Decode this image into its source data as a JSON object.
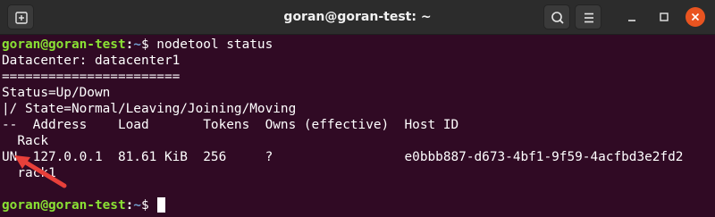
{
  "window": {
    "title": "goran@goran-test: ~"
  },
  "titlebar_buttons": {
    "new_tab_icon": "new-tab-icon",
    "search_icon": "search-icon",
    "menu_icon": "hamburger-menu-icon",
    "minimize_icon": "minimize-icon",
    "maximize_icon": "maximize-icon",
    "close_icon": "close-icon"
  },
  "colors": {
    "terminal_bg": "#300a24",
    "prompt_user": "#8ae234",
    "prompt_path": "#729fcf",
    "close_button": "#e95420",
    "annotation_arrow": "#e8403a"
  },
  "terminal": {
    "prompt1": {
      "user_host": "goran@goran-test",
      "colon": ":",
      "path": "~",
      "dollar": "$ ",
      "command": "nodetool status"
    },
    "lines": [
      "Datacenter: datacenter1",
      "=======================",
      "Status=Up/Down",
      "|/ State=Normal/Leaving/Joining/Moving",
      "--  Address    Load       Tokens  Owns (effective)  Host ID",
      "  Rack",
      "UN  127.0.0.1  81.61 KiB  256     ?                 e0bbb887-d673-4bf1-9f59-4acfbd3e2fd2",
      "  rack1"
    ],
    "prompt2": {
      "user_host": "goran@goran-test",
      "colon": ":",
      "path": "~",
      "dollar": "$ "
    }
  }
}
